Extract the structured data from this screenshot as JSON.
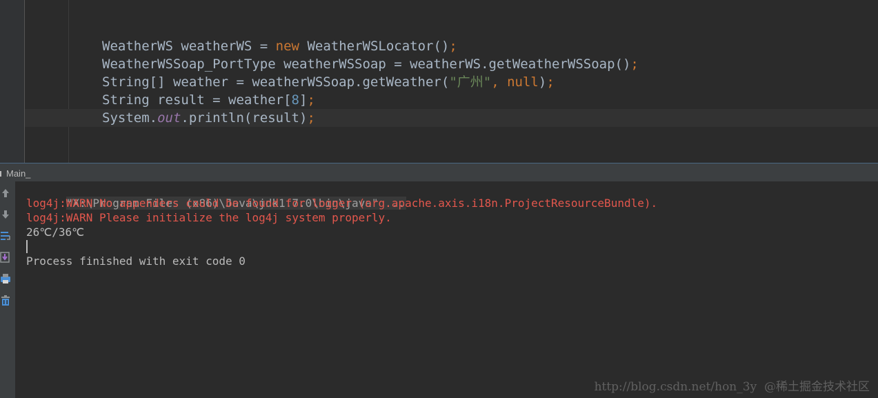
{
  "editor": {
    "lines": [
      {
        "segments": [
          {
            "t": "WeatherWS weatherWS = ",
            "c": ""
          },
          {
            "t": "new",
            "c": "kw"
          },
          {
            "t": " WeatherWSLocator()",
            "c": ""
          },
          {
            "t": ";",
            "c": "kw"
          }
        ]
      },
      {
        "segments": [
          {
            "t": "WeatherWSSoap_PortType weatherWSSoap = weatherWS.getWeatherWSSoap()",
            "c": ""
          },
          {
            "t": ";",
            "c": "kw"
          }
        ]
      },
      {
        "segments": [
          {
            "t": "String[] weather = weatherWSSoap.getWeather(",
            "c": ""
          },
          {
            "t": "\"广州\"",
            "c": "str"
          },
          {
            "t": ", ",
            "c": "kw"
          },
          {
            "t": "null",
            "c": "kw"
          },
          {
            "t": ")",
            "c": ""
          },
          {
            "t": ";",
            "c": "kw"
          }
        ]
      },
      {
        "segments": [
          {
            "t": "String result = weather[",
            "c": ""
          },
          {
            "t": "8",
            "c": "num"
          },
          {
            "t": "]",
            "c": ""
          },
          {
            "t": ";",
            "c": "kw"
          }
        ]
      },
      {
        "segments": [
          {
            "t": "System.",
            "c": ""
          },
          {
            "t": "out",
            "c": "field"
          },
          {
            "t": ".println(result)",
            "c": ""
          },
          {
            "t": ";",
            "c": "kw"
          }
        ]
      }
    ]
  },
  "run_panel": {
    "tab_label": "Main_",
    "toolbar_icons": [
      "rerun-icon",
      "scroll-down-icon",
      "soft-wrap-icon",
      "scroll-to-end-icon",
      "print-icon",
      "clear-all-icon"
    ]
  },
  "console": {
    "command": "\"X:\\Program Files (x86)\\Java\\jdk1.7.0\\bin\\java\" ...",
    "warn1": "log4j:WARN No appenders could be found for logger (org.apache.axis.i18n.ProjectResourceBundle).",
    "warn2": "log4j:WARN Please initialize the log4j system properly.",
    "result": "26℃/36℃",
    "exit": "Process finished with exit code 0"
  },
  "watermark": "http://blog.csdn.net/hon_3y  @稀土掘金技术社区",
  "colors": {
    "keyword": "#cc7832",
    "string": "#6a8759",
    "number": "#6897bb",
    "field": "#9876aa",
    "error": "#e3574d"
  }
}
